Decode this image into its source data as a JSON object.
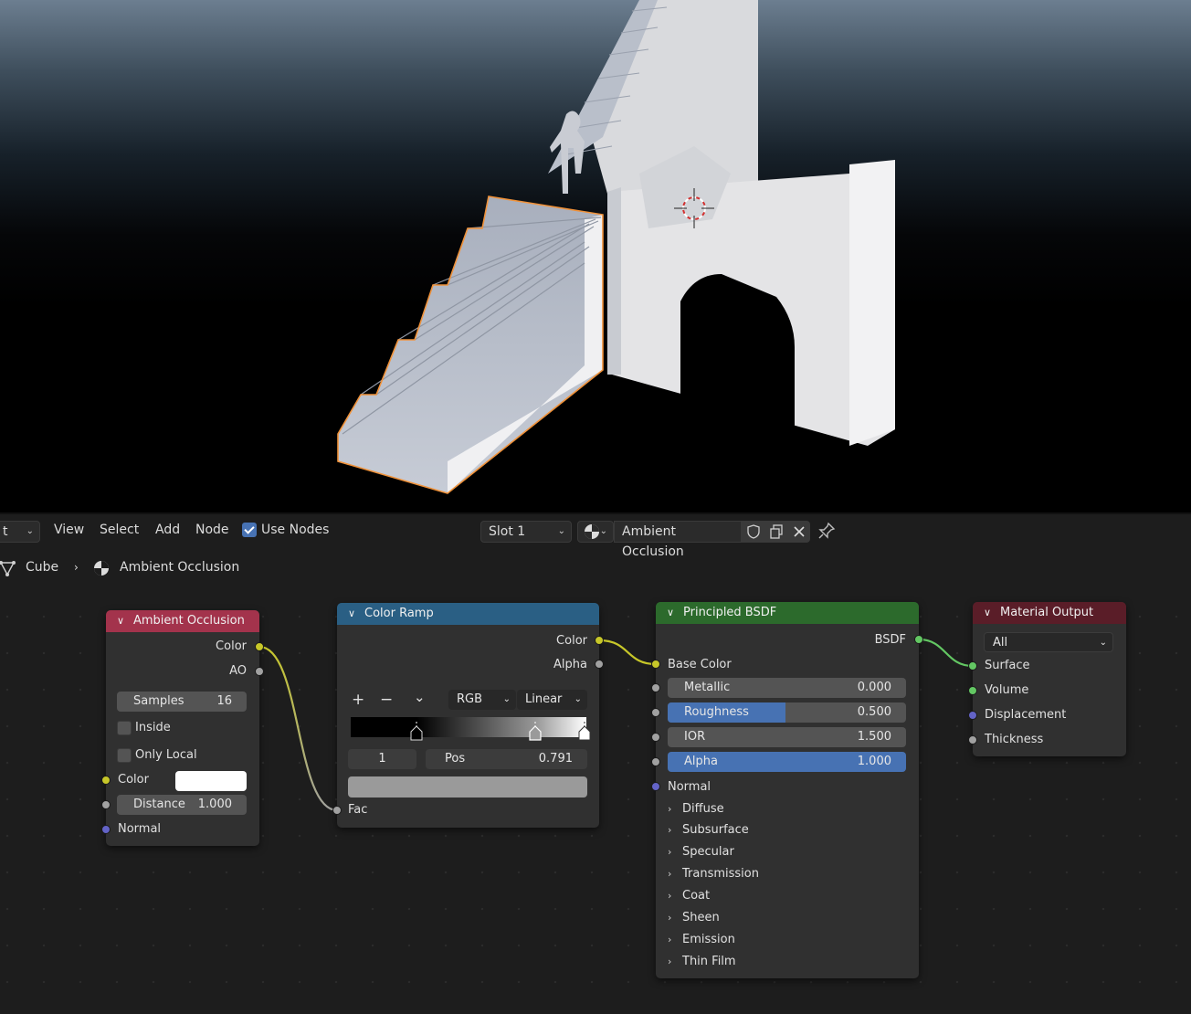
{
  "header": {
    "editor_type_partial": "t",
    "menu": [
      "View",
      "Select",
      "Add",
      "Node"
    ],
    "use_nodes_label": "Use Nodes",
    "use_nodes_checked": true,
    "slot_label": "Slot 1",
    "material_name": "Ambient Occlusion"
  },
  "breadcrumb": {
    "object": "Cube",
    "material": "Ambient Occlusion"
  },
  "nodes": {
    "ao": {
      "title": "Ambient Occlusion",
      "out_color": "Color",
      "out_ao": "AO",
      "samples_label": "Samples",
      "samples_value": "16",
      "inside_label": "Inside",
      "only_local_label": "Only Local",
      "in_color": "Color",
      "color_swatch": "#ffffff",
      "distance_label": "Distance",
      "distance_value": "1.000",
      "in_normal": "Normal"
    },
    "ramp": {
      "title": "Color Ramp",
      "out_color": "Color",
      "out_alpha": "Alpha",
      "add_glyph": "+",
      "remove_glyph": "−",
      "menu_glyph": "⌄",
      "mode": "RGB",
      "interpolation": "Linear",
      "stop_index": "1",
      "pos_label": "Pos",
      "pos_value": "0.791",
      "stop_color": "#9a9a9a",
      "in_fac": "Fac"
    },
    "bsdf": {
      "title": "Principled BSDF",
      "out_bsdf": "BSDF",
      "in_base_color": "Base Color",
      "metallic_label": "Metallic",
      "metallic_value": "0.000",
      "roughness_label": "Roughness",
      "roughness_value": "0.500",
      "ior_label": "IOR",
      "ior_value": "1.500",
      "alpha_label": "Alpha",
      "alpha_value": "1.000",
      "in_normal": "Normal",
      "panels": [
        "Diffuse",
        "Subsurface",
        "Specular",
        "Transmission",
        "Coat",
        "Sheen",
        "Emission",
        "Thin Film"
      ]
    },
    "output": {
      "title": "Material Output",
      "target": "All",
      "in_surface": "Surface",
      "in_volume": "Volume",
      "in_displacement": "Displacement",
      "in_thickness": "Thickness"
    }
  },
  "colors": {
    "ao_header": "#a3334c",
    "ramp_header": "#2a5f84",
    "bsdf_header": "#2c6a2c",
    "output_header": "#5a1d28",
    "selection_outline": "#f0923a"
  }
}
